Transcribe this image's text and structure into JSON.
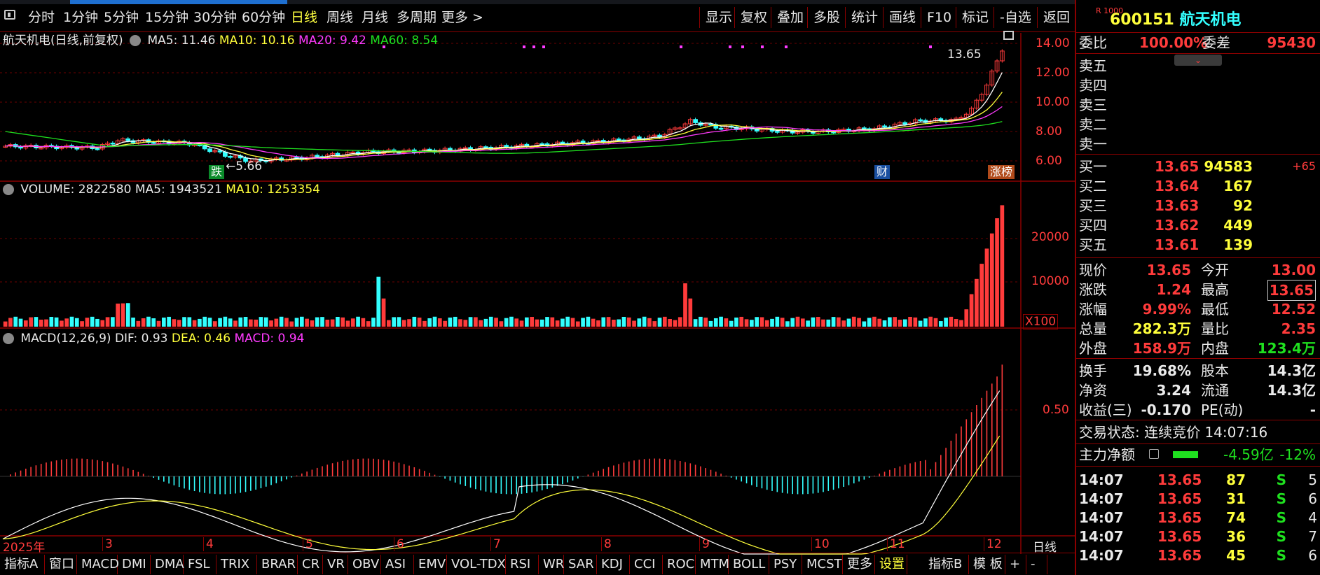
{
  "toolbar": {
    "periods": [
      "分时",
      "1分钟",
      "5分钟",
      "15分钟",
      "30分钟",
      "60分钟",
      "日线",
      "周线",
      "月线",
      "多周期",
      "更多 >"
    ],
    "selected_period": "日线",
    "right_buttons": [
      "显示",
      "复权",
      "叠加",
      "多股",
      "统计",
      "画线",
      "F10",
      "标记",
      "-自选",
      "返回"
    ]
  },
  "main_chart": {
    "title": "航天机电(日线,前复权)",
    "ma5": "MA5: 11.46",
    "ma10": "MA10: 10.16",
    "ma20": "MA20: 9.42",
    "ma60": "MA60: 8.54",
    "price_ticks": [
      "14.00",
      "12.00",
      "10.00",
      "8.00",
      "6.00"
    ],
    "high_label": "13.65",
    "low_label": "5.66",
    "tag_fall": "跌",
    "tag_finance": "财",
    "tag_rank": "涨榜"
  },
  "volume_chart": {
    "title": "VOLUME: 2822580",
    "ma5": "MA5: 1943521",
    "ma10": "MA10: 1253354",
    "ticks": [
      "20000",
      "10000"
    ],
    "unit": "X100"
  },
  "macd_chart": {
    "title": "MACD(12,26,9)",
    "dif": "DIF: 0.93",
    "dea": "DEA: 0.46",
    "macd": "MACD: 0.94",
    "ticks": [
      "0.50"
    ]
  },
  "x_axis": {
    "year_label": "2025年",
    "months": [
      "3",
      "4",
      "5",
      "6",
      "7",
      "8",
      "9",
      "10",
      "11",
      "12"
    ],
    "period_label": "日线"
  },
  "bottom_tabs": [
    "指标A",
    "窗口",
    "MACD",
    "DMI",
    "DMA",
    "FSL",
    "TRIX",
    "BRAR",
    "CR",
    "VR",
    "OBV",
    "ASI",
    "EMV",
    "VOL-TDX",
    "RSI",
    "WR",
    "SAR",
    "KDJ",
    "CCI",
    "ROC",
    "MTM",
    "BOLL",
    "PSY",
    "MCST",
    "更多",
    "设置",
    "指标B",
    "模 板",
    "+",
    "-"
  ],
  "quote": {
    "badge": "R 1000",
    "code": "600151",
    "name": "航天机电",
    "wei_bi_label": "委比",
    "wei_bi": "100.00%",
    "wei_cha_label": "委差",
    "wei_cha": "95430",
    "sell_labels": [
      "卖五",
      "卖四",
      "卖三",
      "卖二",
      "卖一"
    ],
    "buy": [
      {
        "label": "买一",
        "price": "13.65",
        "vol": "94583",
        "chg": "+65"
      },
      {
        "label": "买二",
        "price": "13.64",
        "vol": "167",
        "chg": ""
      },
      {
        "label": "买三",
        "price": "13.63",
        "vol": "92",
        "chg": ""
      },
      {
        "label": "买四",
        "price": "13.62",
        "vol": "449",
        "chg": ""
      },
      {
        "label": "买五",
        "price": "13.61",
        "vol": "139",
        "chg": ""
      }
    ],
    "stats": [
      {
        "l1": "现价",
        "v1": "13.65",
        "l2": "今开",
        "v2": "13.00"
      },
      {
        "l1": "涨跌",
        "v1": "1.24",
        "l2": "最高",
        "v2": "13.65"
      },
      {
        "l1": "涨幅",
        "v1": "9.99%",
        "l2": "最低",
        "v2": "12.52"
      },
      {
        "l1": "总量",
        "v1": "282.3万",
        "l2": "量比",
        "v2": "2.35"
      },
      {
        "l1": "外盘",
        "v1": "158.9万",
        "l2": "内盘",
        "v2": "123.4万"
      }
    ],
    "stats2": [
      {
        "l1": "换手",
        "v1": "19.68%",
        "l2": "股本",
        "v2": "14.3亿"
      },
      {
        "l1": "净资",
        "v1": "3.24",
        "l2": "流通",
        "v2": "14.3亿"
      },
      {
        "l1": "收益(三)",
        "v1": "-0.170",
        "l2": "PE(动)",
        "v2": "-"
      }
    ],
    "trade_status": "交易状态: 连续竞价 14:07:16",
    "main_flow_label": "主力净额",
    "main_flow_value": "-4.59亿",
    "main_flow_pct": "-12%",
    "ticks": [
      {
        "time": "14:07",
        "price": "13.65",
        "vol": "87",
        "side": "S",
        "n": "5"
      },
      {
        "time": "14:07",
        "price": "13.65",
        "vol": "31",
        "side": "S",
        "n": "6"
      },
      {
        "time": "14:07",
        "price": "13.65",
        "vol": "74",
        "side": "S",
        "n": "4"
      },
      {
        "time": "14:07",
        "price": "13.65",
        "vol": "36",
        "side": "S",
        "n": "7"
      },
      {
        "time": "14:07",
        "price": "13.65",
        "vol": "45",
        "side": "S",
        "n": "6"
      }
    ]
  },
  "colors": {
    "up": "#ff3b3b",
    "down": "#3ff",
    "ma5": "#ffffff",
    "ma10": "#ffff3b",
    "ma20": "#ff3bff",
    "ma60": "#1fe01f"
  }
}
